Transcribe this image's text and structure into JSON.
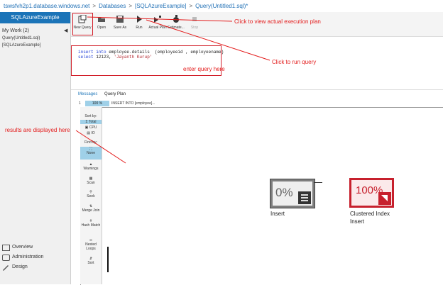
{
  "breadcrumb": {
    "server": "tswsfvh2p1.database.windows.net",
    "databases": "Databases",
    "db": "[SQLAzureExample]",
    "query": "Query(Untitled1.sql)*"
  },
  "sidebar": {
    "db_title": "SQLAzureExample",
    "my_work": "My Work (2)",
    "items": [
      "Query(Untitled1.sql)",
      "[SQLAzureExample]"
    ],
    "nav": [
      "Overview",
      "Administration",
      "Design"
    ]
  },
  "toolbar": {
    "buttons": [
      "New Query",
      "Open",
      "Save As",
      "Run",
      "Actual Plan",
      "Estimate...",
      "Stop"
    ]
  },
  "editor": {
    "line1": {
      "kw1": "insert into",
      "rest": " employee.details  (employeeid , employeename)"
    },
    "line2": {
      "kw1": "select",
      "num": " 12123, ",
      "str": "'Jayanth Kurup'"
    }
  },
  "results": {
    "tabs": [
      "Messages",
      "Query Plan"
    ],
    "row_index": "1",
    "row_pct": "100 %",
    "row_text": "INSERT INTO [employee]..."
  },
  "plan_sidebar": {
    "sort_by": "Sort by:",
    "sort_opts": [
      "Total",
      "CPU",
      "IO"
    ],
    "find_by": "Find by:",
    "find_opts": [
      "None",
      "Warnings",
      "Scan",
      "Seek",
      "Merge Join",
      "Hash Match",
      "Nested Loops",
      "Sort"
    ]
  },
  "plan": {
    "insert": {
      "pct": "0%",
      "label": "Insert"
    },
    "clustered": {
      "pct": "100%",
      "label1": "Clustered Index",
      "label2": "Insert"
    }
  },
  "annotations": {
    "actual_plan": "Click to view actual execution plan",
    "run": "Click to run query",
    "enter": "enter query here",
    "results": "results are displayed here"
  },
  "colors": {
    "accent": "#1b74b8",
    "annotation": "#e31b1b",
    "critical": "#c7202d"
  }
}
